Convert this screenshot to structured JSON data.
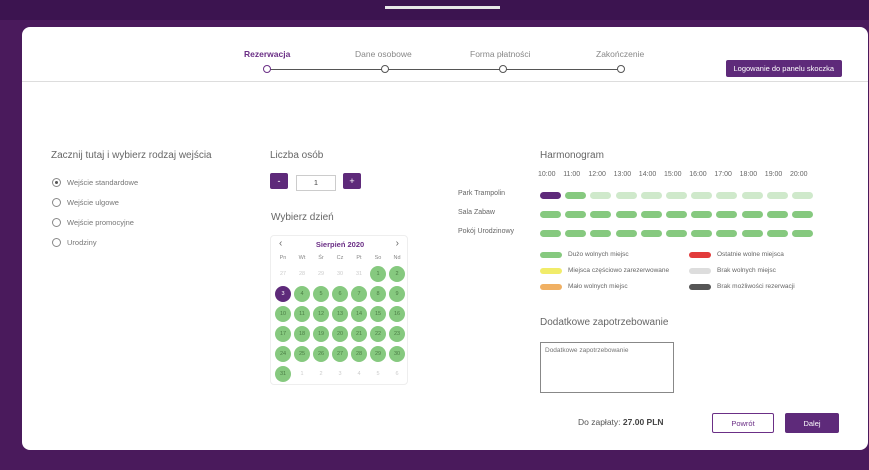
{
  "steps": [
    {
      "label": "Rezerwacja",
      "active": true
    },
    {
      "label": "Dane osobowe",
      "active": false
    },
    {
      "label": "Forma płatności",
      "active": false
    },
    {
      "label": "Zakończenie",
      "active": false
    }
  ],
  "login_button": "Logowanie do panelu skoczka",
  "entry": {
    "heading": "Zacznij tutaj i wybierz rodzaj wejścia",
    "options": [
      {
        "label": "Wejście standardowe",
        "checked": true
      },
      {
        "label": "Wejście ulgowe",
        "checked": false
      },
      {
        "label": "Wejście promocyjne",
        "checked": false
      },
      {
        "label": "Urodziny",
        "checked": false
      }
    ]
  },
  "people": {
    "heading": "Liczba osób",
    "minus": "-",
    "plus": "+",
    "value": "1"
  },
  "day": {
    "heading": "Wybierz dzień"
  },
  "calendar": {
    "prev": "‹",
    "next": "›",
    "title": "Sierpień 2020",
    "weekdays": [
      "Pn",
      "Wt",
      "Śr",
      "Cz",
      "Pt",
      "So",
      "Nd"
    ],
    "weeks": [
      [
        {
          "d": "27",
          "s": "muted"
        },
        {
          "d": "28",
          "s": "muted"
        },
        {
          "d": "29",
          "s": "muted"
        },
        {
          "d": "30",
          "s": "muted"
        },
        {
          "d": "31",
          "s": "muted"
        },
        {
          "d": "1",
          "s": "avail"
        },
        {
          "d": "2",
          "s": "avail"
        }
      ],
      [
        {
          "d": "3",
          "s": "selected"
        },
        {
          "d": "4",
          "s": "avail"
        },
        {
          "d": "5",
          "s": "avail"
        },
        {
          "d": "6",
          "s": "avail"
        },
        {
          "d": "7",
          "s": "avail"
        },
        {
          "d": "8",
          "s": "avail"
        },
        {
          "d": "9",
          "s": "avail"
        }
      ],
      [
        {
          "d": "10",
          "s": "avail"
        },
        {
          "d": "11",
          "s": "avail"
        },
        {
          "d": "12",
          "s": "avail"
        },
        {
          "d": "13",
          "s": "avail"
        },
        {
          "d": "14",
          "s": "avail"
        },
        {
          "d": "15",
          "s": "avail"
        },
        {
          "d": "16",
          "s": "avail"
        }
      ],
      [
        {
          "d": "17",
          "s": "avail"
        },
        {
          "d": "18",
          "s": "avail"
        },
        {
          "d": "19",
          "s": "avail"
        },
        {
          "d": "20",
          "s": "avail"
        },
        {
          "d": "21",
          "s": "avail"
        },
        {
          "d": "22",
          "s": "avail"
        },
        {
          "d": "23",
          "s": "avail"
        }
      ],
      [
        {
          "d": "24",
          "s": "avail"
        },
        {
          "d": "25",
          "s": "avail"
        },
        {
          "d": "26",
          "s": "avail"
        },
        {
          "d": "27",
          "s": "avail"
        },
        {
          "d": "28",
          "s": "avail"
        },
        {
          "d": "29",
          "s": "avail"
        },
        {
          "d": "30",
          "s": "avail"
        }
      ],
      [
        {
          "d": "31",
          "s": "avail"
        },
        {
          "d": "1",
          "s": "muted"
        },
        {
          "d": "2",
          "s": "muted"
        },
        {
          "d": "3",
          "s": "muted"
        },
        {
          "d": "4",
          "s": "muted"
        },
        {
          "d": "5",
          "s": "muted"
        },
        {
          "d": "6",
          "s": "muted"
        }
      ]
    ]
  },
  "schedule": {
    "heading": "Harmonogram",
    "times": [
      "10:00",
      "11:00",
      "12:00",
      "13:00",
      "14:00",
      "15:00",
      "16:00",
      "17:00",
      "18:00",
      "19:00",
      "20:00"
    ],
    "rooms": [
      {
        "name": "Park Trampolin",
        "slots": [
          "purple",
          "green",
          "light",
          "light",
          "light",
          "light",
          "light",
          "light",
          "light",
          "light",
          "light"
        ]
      },
      {
        "name": "Sala Zabaw",
        "slots": [
          "green",
          "green",
          "green",
          "green",
          "green",
          "green",
          "green",
          "green",
          "green",
          "green",
          "green"
        ]
      },
      {
        "name": "Pokój Urodzinowy",
        "slots": [
          "green",
          "green",
          "green",
          "green",
          "green",
          "green",
          "green",
          "green",
          "green",
          "green",
          "green"
        ]
      }
    ],
    "colors": {
      "purple": "#5e2a7a",
      "green": "#86c97f",
      "light": "#cfe9cb"
    },
    "legend": [
      {
        "label": "Dużo wolnych miejsc",
        "color": "#86c97f"
      },
      {
        "label": "Ostatnie wolne miejsca",
        "color": "#e23b3b"
      },
      {
        "label": "Miejsca częściowo zarezerwowane",
        "color": "#f1ec6a"
      },
      {
        "label": "Brak wolnych miejsc",
        "color": "#dddddd"
      },
      {
        "label": "Mało wolnych miejsc",
        "color": "#f0b063"
      },
      {
        "label": "Brak możliwości rezerwacji",
        "color": "#555555"
      }
    ]
  },
  "extra": {
    "heading": "Dodatkowe zapotrzebowanie",
    "placeholder": "Dodatkowe zapotrzebowanie"
  },
  "footer": {
    "total_label": "Do zapłaty:",
    "total_value": "27.00 PLN",
    "back": "Powrót",
    "next": "Dalej"
  }
}
